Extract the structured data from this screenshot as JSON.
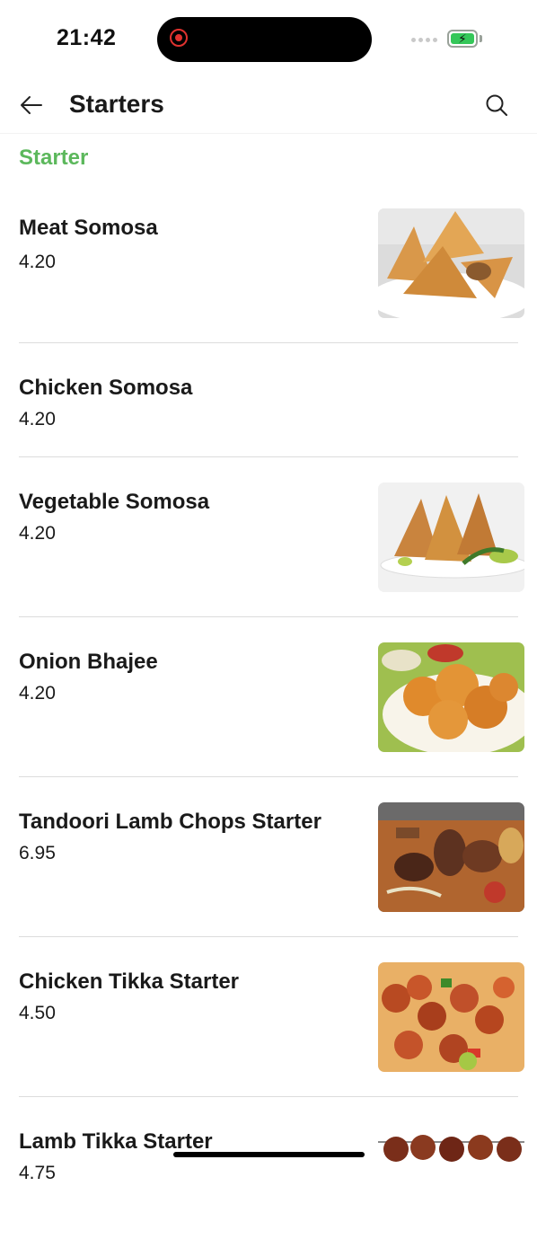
{
  "status_bar": {
    "time": "21:42"
  },
  "header": {
    "title": "Starters",
    "back_icon": "arrow-left-icon",
    "search_icon": "search-icon"
  },
  "section": {
    "title": "Starter",
    "accent_color": "#5cb85c"
  },
  "items": [
    {
      "name": "Meat Somosa",
      "price": "4.20",
      "has_image": true,
      "image": "meat-somosa-photo"
    },
    {
      "name": "Chicken Somosa",
      "price": "4.20",
      "has_image": false
    },
    {
      "name": "Vegetable Somosa",
      "price": "4.20",
      "has_image": true,
      "image": "vegetable-somosa-photo"
    },
    {
      "name": "Onion Bhajee",
      "price": "4.20",
      "has_image": true,
      "image": "onion-bhajee-photo"
    },
    {
      "name": "Tandoori Lamb Chops Starter",
      "price": "6.95",
      "has_image": true,
      "image": "lamb-chops-photo"
    },
    {
      "name": "Chicken Tikka Starter",
      "price": "4.50",
      "has_image": true,
      "image": "chicken-tikka-photo"
    },
    {
      "name": "Lamb Tikka Starter",
      "price": "4.75",
      "has_image": true,
      "image": "lamb-tikka-photo"
    }
  ]
}
